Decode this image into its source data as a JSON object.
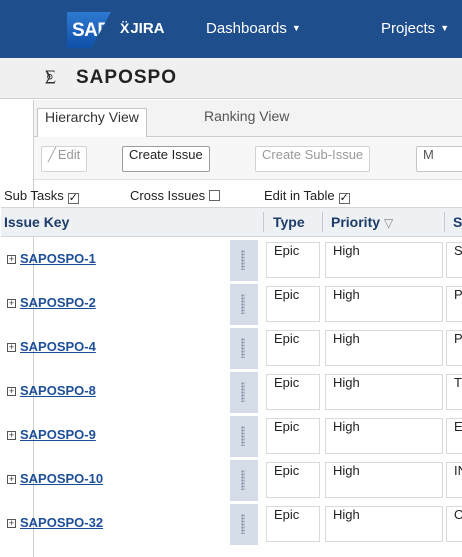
{
  "header": {
    "sap_logo": "SAP",
    "jira_logo": "JIRA",
    "nav": [
      {
        "label": "Dashboards"
      },
      {
        "label": "Projects"
      }
    ]
  },
  "project": {
    "name": "SAPOSPO"
  },
  "tabs": [
    {
      "label": "Hierarchy View",
      "active": true
    },
    {
      "label": "Ranking View",
      "active": false
    }
  ],
  "toolbar": {
    "edit": "Edit",
    "create_issue": "Create Issue",
    "create_sub_issue": "Create Sub-Issue",
    "more": "M"
  },
  "options": {
    "sub_tasks": {
      "label": "Sub Tasks",
      "checked": true
    },
    "cross_issues": {
      "label": "Cross Issues",
      "checked": false
    },
    "edit_in_table": {
      "label": "Edit in Table",
      "checked": true
    }
  },
  "table": {
    "columns": [
      "Issue Key",
      "Type",
      "Priority",
      "S"
    ],
    "rows": [
      {
        "key": "SAPOSPO-1",
        "type": "Epic",
        "priority": "High",
        "status": "ST"
      },
      {
        "key": "SAPOSPO-2",
        "type": "Epic",
        "priority": "High",
        "status": "PI"
      },
      {
        "key": "SAPOSPO-4",
        "type": "Epic",
        "priority": "High",
        "status": "PC"
      },
      {
        "key": "SAPOSPO-8",
        "type": "Epic",
        "priority": "High",
        "status": "TC"
      },
      {
        "key": "SAPOSPO-9",
        "type": "Epic",
        "priority": "High",
        "status": "EX"
      },
      {
        "key": "SAPOSPO-10",
        "type": "Epic",
        "priority": "High",
        "status": "IN"
      },
      {
        "key": "SAPOSPO-32",
        "type": "Epic",
        "priority": "High",
        "status": "OI"
      }
    ]
  },
  "colors": {
    "header_bg": "#1e4e8c",
    "link": "#1d4f99",
    "handle_bg": "#d4dde8"
  }
}
